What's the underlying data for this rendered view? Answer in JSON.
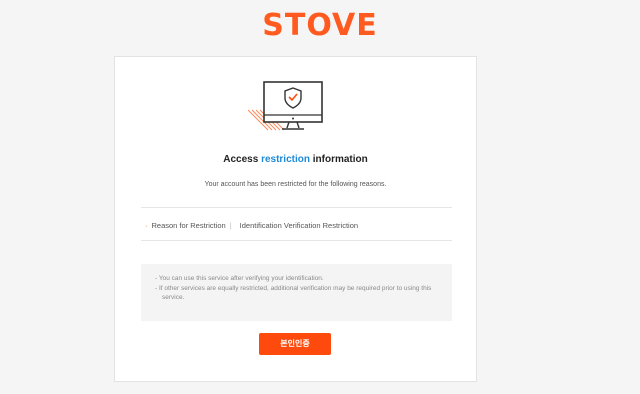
{
  "brand": {
    "logo_text": "STOVE",
    "color": "#ff5a1f"
  },
  "header": {
    "title_prefix": "Access ",
    "title_highlight": "restriction",
    "title_suffix": " information",
    "subtitle": "Your account has been restricted for the following reasons."
  },
  "reason": {
    "label": "Reason for Restriction",
    "separator": "|",
    "value": "Identification Verification Restriction"
  },
  "notices": [
    "- You can use this service after verifying your identification.",
    "- If other services are equally restricted, additional verification may be required prior to using this service."
  ],
  "actions": {
    "verify_label": "본인인증"
  },
  "colors": {
    "accent": "#ff4a0e",
    "highlight": "#1e8ad7"
  },
  "icons": {
    "illustration": "monitor-shield-check-icon"
  }
}
